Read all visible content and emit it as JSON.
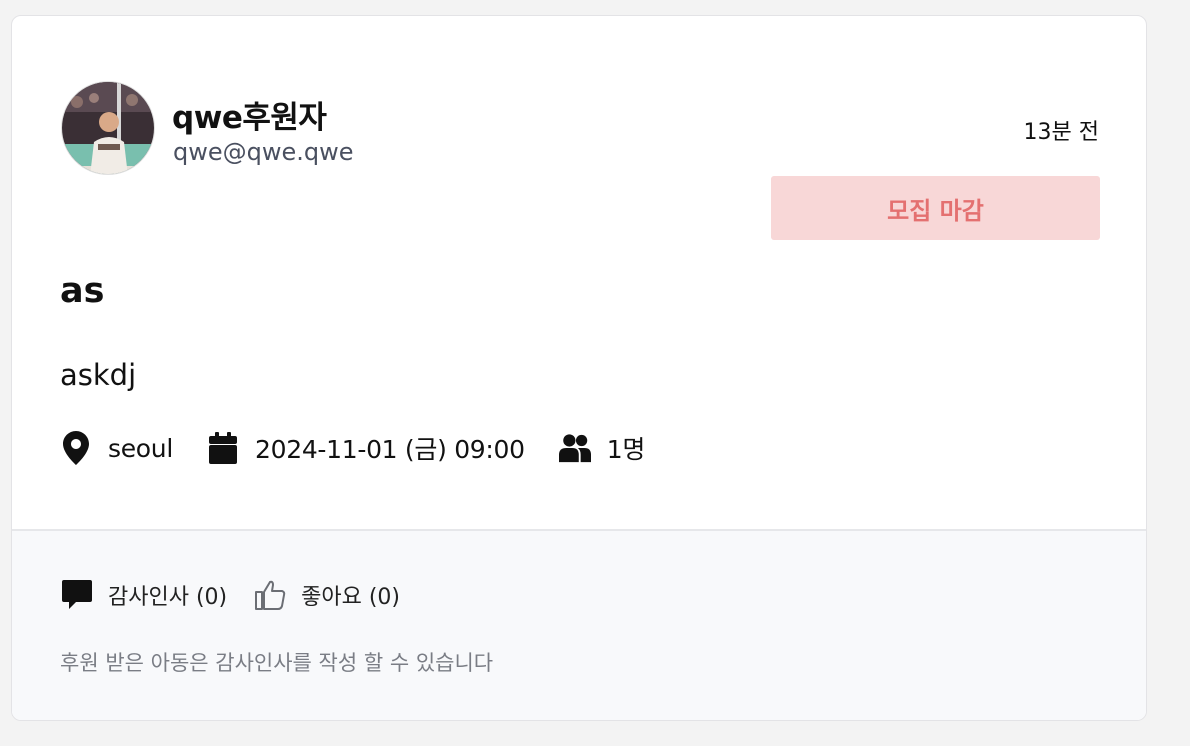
{
  "author": {
    "name": "qwe후원자",
    "email": "qwe@qwe.qwe"
  },
  "post": {
    "time_ago": "13분 전",
    "status_label": "모집 마감",
    "title": "as",
    "content": "askdj",
    "location": "seoul",
    "datetime": "2024-11-01 (금) 09:00",
    "people": "1명"
  },
  "actions": {
    "thanks_label": "감사인사 (0)",
    "like_label": "좋아요 (0)"
  },
  "footer_note": "후원 받은 아동은 감사인사를 작성 할 수 있습니다",
  "icons": {
    "location": "map-pin-icon",
    "date": "calendar-icon",
    "people": "users-icon",
    "thanks": "comment-icon",
    "like": "thumbs-up-icon"
  },
  "colors": {
    "status_bg": "#f8d7d7",
    "status_text": "#e47070",
    "footer_bg": "#f8f9fb"
  }
}
